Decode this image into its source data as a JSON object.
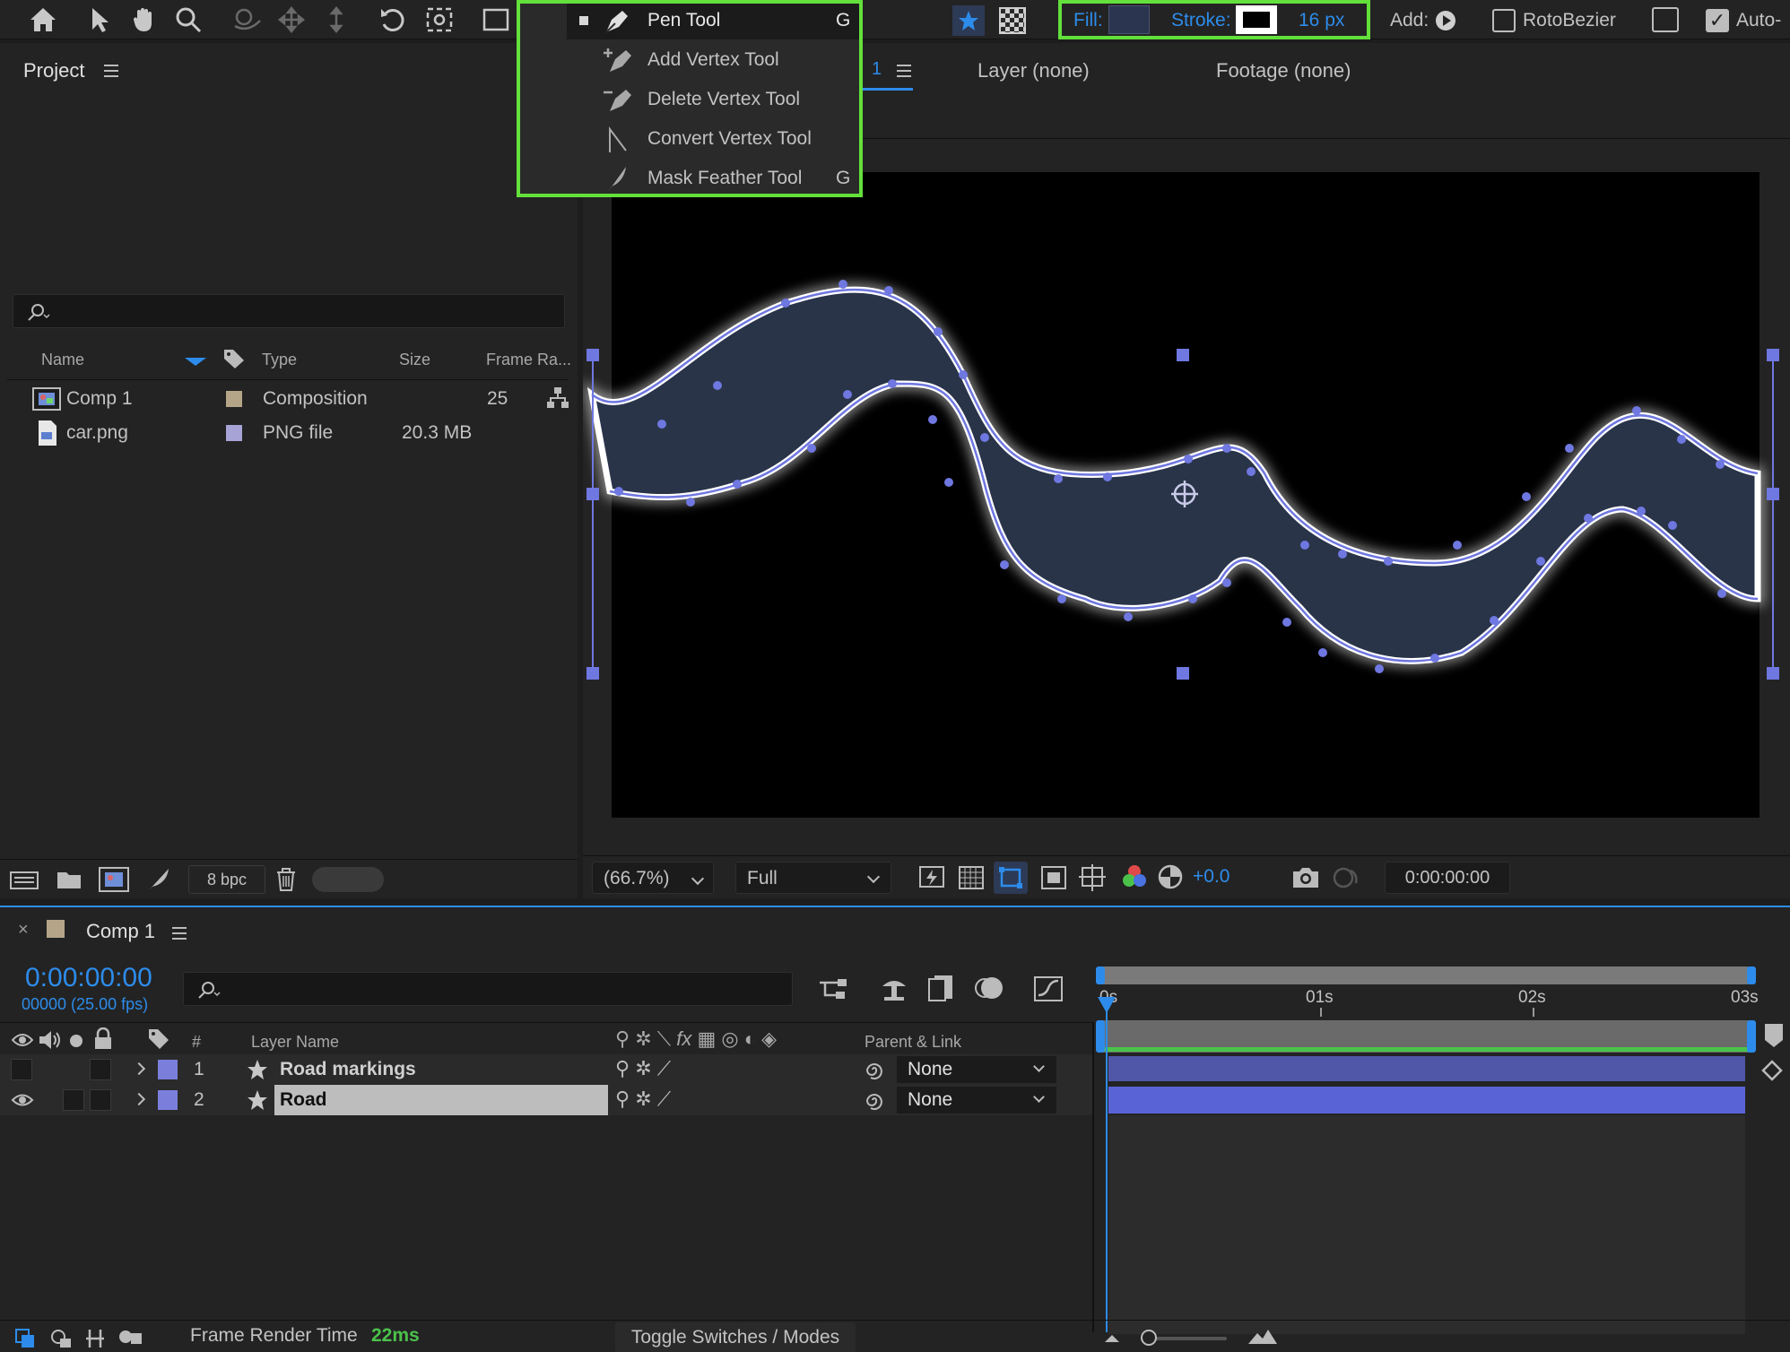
{
  "toolbar": {
    "fill_label": "Fill:",
    "stroke_label": "Stroke:",
    "stroke_width": "16 px",
    "add_label": "Add:",
    "rotobezier_label": "RotoBezier",
    "auto_label": "Auto-",
    "tools": [
      "home-icon",
      "selection-arrow-icon",
      "hand-icon",
      "zoom-icon",
      "orbit-icon",
      "pan-icon",
      "dolly-icon",
      "rotate-icon",
      "anchor-icon",
      "rectangle-icon",
      "pen-icon"
    ]
  },
  "pen_menu": {
    "items": [
      {
        "label": "Pen Tool",
        "shortcut": "G",
        "active": true,
        "icon": "pen-icon"
      },
      {
        "label": "Add Vertex Tool",
        "shortcut": "",
        "active": false,
        "icon": "add-vertex-icon"
      },
      {
        "label": "Delete Vertex Tool",
        "shortcut": "",
        "active": false,
        "icon": "delete-vertex-icon"
      },
      {
        "label": "Convert Vertex Tool",
        "shortcut": "",
        "active": false,
        "icon": "convert-vertex-icon"
      },
      {
        "label": "Mask Feather Tool",
        "shortcut": "G",
        "active": false,
        "icon": "feather-icon"
      }
    ]
  },
  "project": {
    "title": "Project",
    "columns": {
      "name": "Name",
      "type": "Type",
      "size": "Size",
      "framerate": "Frame Ra..."
    },
    "items": [
      {
        "name": "Comp 1",
        "type": "Composition",
        "size": "",
        "framerate": "25",
        "label_color": "#b5a588",
        "icon": "composition-icon"
      },
      {
        "name": "car.png",
        "type": "PNG file",
        "size": "20.3 MB",
        "framerate": "",
        "label_color": "#a7a3d6",
        "icon": "png-file-icon"
      }
    ],
    "bpc": "8 bpc"
  },
  "viewer": {
    "tab_comp_suffix": "1",
    "layer_tab": "Layer (none)",
    "footage_tab": "Footage (none)",
    "zoom": "(66.7%)",
    "resolution": "Full",
    "exposure": "+0.0",
    "timecode": "0:00:00:00"
  },
  "timeline": {
    "comp_name": "Comp 1",
    "comp_color": "#b5a588",
    "timecode": "0:00:00:00",
    "frame_info": "00000 (25.00 fps)",
    "columns": {
      "num": "#",
      "layer_name": "Layer Name",
      "parent": "Parent & Link"
    },
    "layers": [
      {
        "num": "1",
        "name": "Road markings",
        "parent": "None",
        "color": "#7b7fdb",
        "visible": false,
        "selected": false
      },
      {
        "num": "2",
        "name": "Road",
        "parent": "None",
        "color": "#7b7fdb",
        "visible": true,
        "selected": true
      }
    ],
    "ruler": [
      "0s",
      "01s",
      "02s",
      "03s"
    ],
    "frame_render_label": "Frame Render Time",
    "frame_render_value": "22ms",
    "toggle_label": "Toggle Switches / Modes"
  },
  "colors": {
    "accent": "#2d8ceb",
    "highlight": "#63e03b",
    "road": "#293449",
    "path": "#6f77e0"
  }
}
